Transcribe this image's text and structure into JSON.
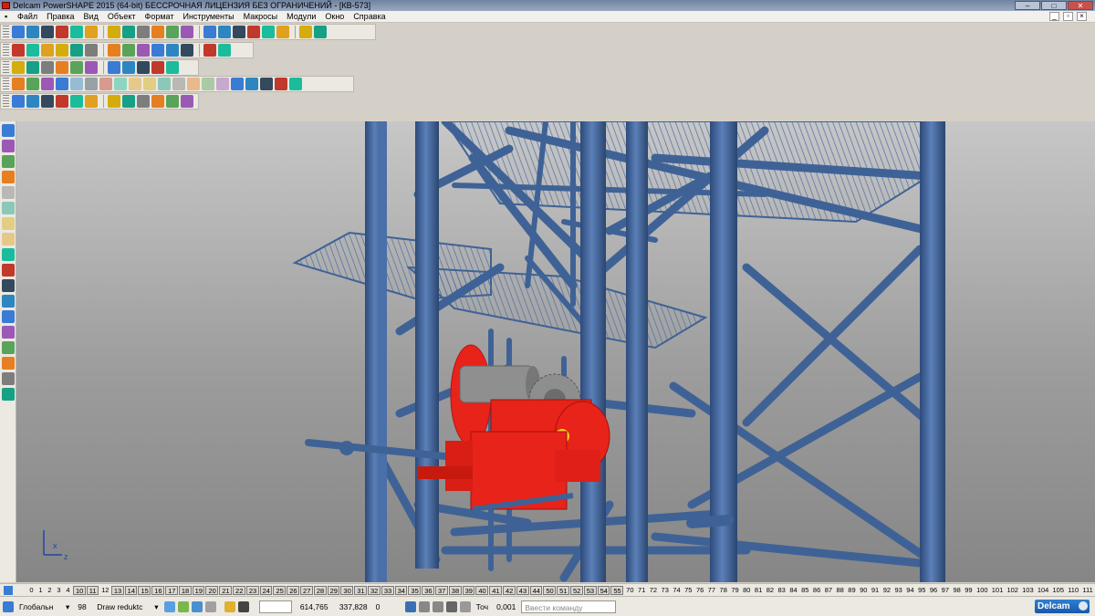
{
  "window": {
    "title": "Delcam PowerSHAPE 2015 (64-bit) БЕССРОЧНАЯ ЛИЦЕНЗИЯ БЕЗ ОГРАНИЧЕНИЙ - [КВ-573]"
  },
  "menu": [
    "Файл",
    "Правка",
    "Вид",
    "Объект",
    "Формат",
    "Инструменты",
    "Макросы",
    "Модули",
    "Окно",
    "Справка"
  ],
  "colors": {
    "truss": "#3f6296",
    "truss_dark": "#27406a",
    "winch": "#e8231a",
    "viewport_top": "#c7c7c7",
    "viewport_bottom": "#868686"
  },
  "layers": {
    "numbers": [
      "0",
      "1",
      "2",
      "3",
      "4",
      "10",
      "11",
      "12",
      "13",
      "14",
      "15",
      "16",
      "17",
      "18",
      "19",
      "20",
      "21",
      "22",
      "23",
      "24",
      "25",
      "26",
      "27",
      "28",
      "29",
      "30",
      "31",
      "32",
      "33",
      "34",
      "35",
      "36",
      "37",
      "38",
      "39",
      "40",
      "41",
      "42",
      "43",
      "44",
      "50",
      "51",
      "52",
      "53",
      "54",
      "55",
      "70",
      "71",
      "72",
      "73",
      "74",
      "75",
      "76",
      "77",
      "78",
      "79",
      "80",
      "81",
      "82",
      "83",
      "84",
      "85",
      "86",
      "87",
      "88",
      "89",
      "90",
      "91",
      "92",
      "93",
      "94",
      "95",
      "96",
      "97",
      "98",
      "99",
      "100",
      "101",
      "102",
      "103",
      "104",
      "105",
      "110",
      "111"
    ],
    "boxed": [
      "10",
      "11",
      "13",
      "14",
      "15",
      "16",
      "17",
      "18",
      "19",
      "20",
      "21",
      "22",
      "23",
      "24",
      "25",
      "26",
      "27",
      "28",
      "29",
      "30",
      "31",
      "32",
      "33",
      "34",
      "35",
      "36",
      "37",
      "38",
      "39",
      "40",
      "41",
      "42",
      "43",
      "44",
      "50",
      "51",
      "52",
      "53",
      "54",
      "55"
    ]
  },
  "status": {
    "workplane": "Глобальн",
    "level": "98",
    "level_name": "Draw reduktc",
    "x": "614,765",
    "y": "337,828",
    "z": "0",
    "tolerance_label": "Точ",
    "tolerance": "0,001",
    "command_placeholder": "Ввести команду",
    "logo": "Delcam"
  },
  "axis": {
    "x": "x",
    "z": "z"
  }
}
